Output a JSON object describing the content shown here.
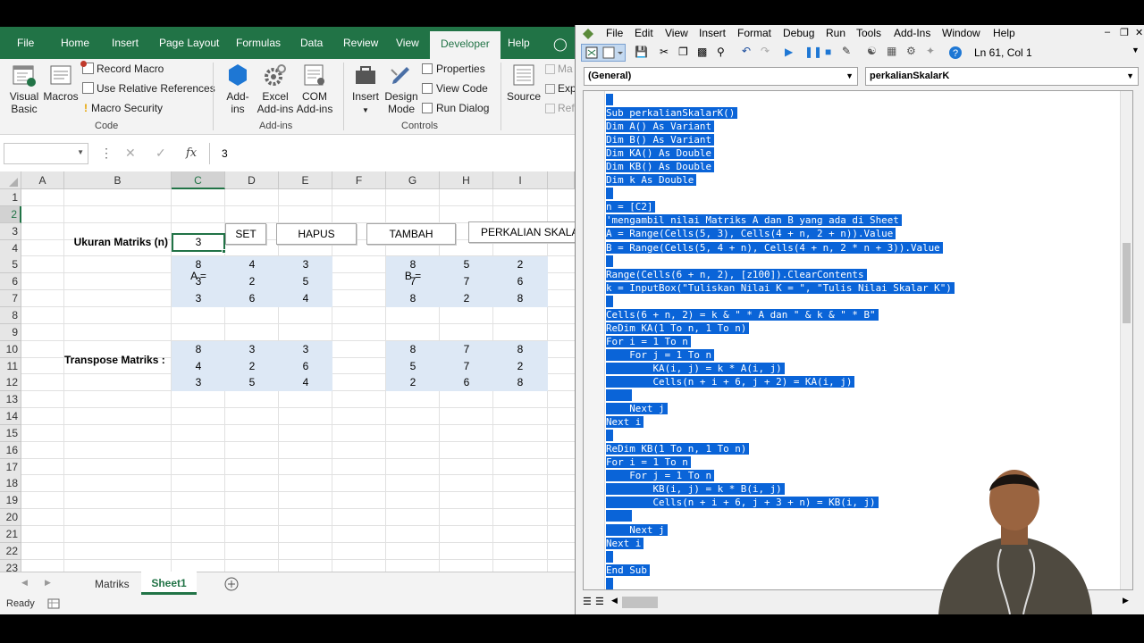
{
  "excel": {
    "tabs": [
      "File",
      "Home",
      "Insert",
      "Page Layout",
      "Formulas",
      "Data",
      "Review",
      "View",
      "Developer",
      "Help"
    ],
    "active_tab": "Developer",
    "ribbon": {
      "visual_basic": "Visual Basic",
      "visual_basic_l1": "Visual",
      "visual_basic_l2": "Basic",
      "macros": "Macros",
      "record_macro": "Record Macro",
      "use_relative": "Use Relative References",
      "macro_security": "Macro Security",
      "group_code": "Code",
      "addins_l1": "Add-",
      "addins_l2": "ins",
      "excel_addins_l1": "Excel",
      "excel_addins_l2": "Add-ins",
      "com_addins_l1": "COM",
      "com_addins_l2": "Add-ins",
      "group_addins": "Add-ins",
      "insert": "Insert",
      "design_l1": "Design",
      "design_l2": "Mode",
      "properties": "Properties",
      "view_code": "View Code",
      "run_dialog": "Run Dialog",
      "group_controls": "Controls",
      "source": "Source",
      "cut1": "Ma",
      "cut2": "Exp",
      "cut3": "Ref"
    },
    "formula_bar": {
      "name_box": "",
      "fx": "fx",
      "value": "3"
    },
    "columns": [
      "A",
      "B",
      "C",
      "D",
      "E",
      "F",
      "G",
      "H",
      "I"
    ],
    "rows": [
      "1",
      "2",
      "3",
      "4",
      "5",
      "6",
      "7",
      "8",
      "9",
      "10",
      "11",
      "12",
      "13",
      "14",
      "15",
      "16",
      "17",
      "18",
      "19",
      "20",
      "21",
      "22",
      "23"
    ],
    "labels": {
      "ukuran": "Ukuran Matriks (n)",
      "n_value": "3",
      "a_eq": "A =",
      "b_eq": "B =",
      "transpose": "Transpose Matriks :"
    },
    "buttons": {
      "set": "SET",
      "hapus": "HAPUS",
      "tambah": "TAMBAH",
      "perkalian": "PERKALIAN SKALAR"
    },
    "matrix_a": [
      [
        "8",
        "4",
        "3"
      ],
      [
        "3",
        "2",
        "5"
      ],
      [
        "3",
        "6",
        "4"
      ]
    ],
    "matrix_b": [
      [
        "8",
        "5",
        "2"
      ],
      [
        "7",
        "7",
        "6"
      ],
      [
        "8",
        "2",
        "8"
      ]
    ],
    "transpose_a": [
      [
        "8",
        "3",
        "3"
      ],
      [
        "4",
        "2",
        "6"
      ],
      [
        "3",
        "5",
        "4"
      ]
    ],
    "transpose_b": [
      [
        "8",
        "7",
        "8"
      ],
      [
        "5",
        "7",
        "2"
      ],
      [
        "2",
        "6",
        "8"
      ]
    ],
    "sheets": [
      "Matriks",
      "Sheet1"
    ],
    "active_sheet": "Sheet1",
    "status": "Ready",
    "accent": "#217346",
    "matrix_fill": "#dde8f5"
  },
  "vbe": {
    "menu": [
      "File",
      "Edit",
      "View",
      "Insert",
      "Format",
      "Debug",
      "Run",
      "Tools",
      "Add-Ins",
      "Window",
      "Help"
    ],
    "position": "Ln 61, Col 1",
    "object_combo": "(General)",
    "proc_combo": "perkalianSkalarK",
    "selection_color": "#0a64d8",
    "code_lines": [
      "",
      "Sub perkalianSkalarK()",
      "Dim A() As Variant",
      "Dim B() As Variant",
      "Dim KA() As Double",
      "Dim KB() As Double",
      "Dim k As Double",
      "",
      "n = [C2]",
      "'mengambil nilai Matriks A dan B yang ada di Sheet",
      "A = Range(Cells(5, 3), Cells(4 + n, 2 + n)).Value",
      "B = Range(Cells(5, 4 + n), Cells(4 + n, 2 * n + 3)).Value",
      "",
      "Range(Cells(6 + n, 2), [z100]).ClearContents",
      "k = InputBox(\"Tuliskan Nilai K = \", \"Tulis Nilai Skalar K\")",
      "",
      "Cells(6 + n, 2) = k & \" * A dan \" & k & \" * B\"",
      "ReDim KA(1 To n, 1 To n)",
      "For i = 1 To n",
      "    For j = 1 To n",
      "        KA(i, j) = k * A(i, j)",
      "        Cells(n + i + 6, j + 2) = KA(i, j)",
      "    ",
      "    Next j",
      "Next i",
      "",
      "ReDim KB(1 To n, 1 To n)",
      "For i = 1 To n",
      "    For j = 1 To n",
      "        KB(i, j) = k * B(i, j)",
      "        Cells(n + i + 6, j + 3 + n) = KB(i, j)",
      "    ",
      "    Next j",
      "Next i",
      "",
      "End Sub",
      ""
    ]
  }
}
